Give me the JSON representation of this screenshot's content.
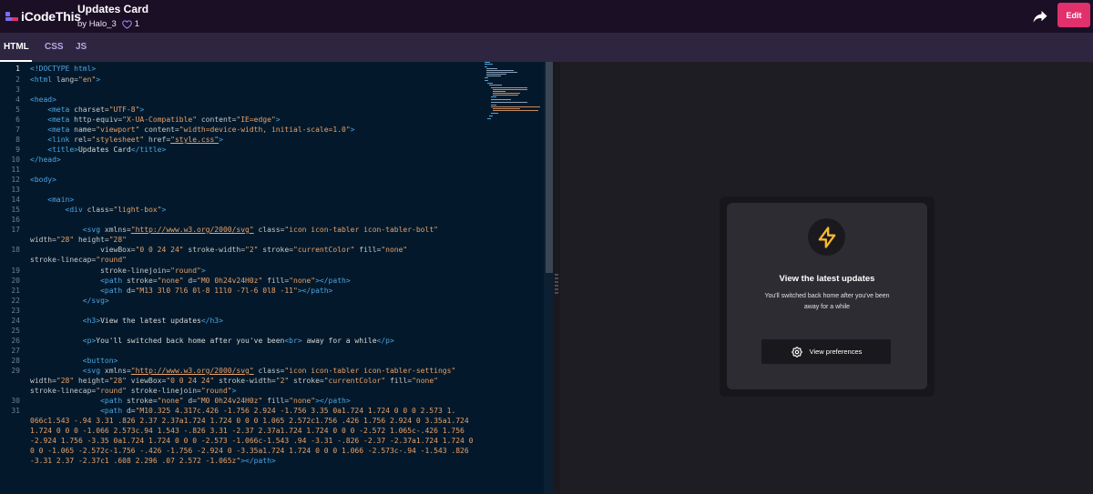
{
  "app": {
    "logo_text": "iCodeThis",
    "brand_colors": [
      "#7b6cf6",
      "#e1306c"
    ]
  },
  "project": {
    "title": "Updates Card",
    "by_label": "by",
    "author": "Halo_3",
    "likes": "1"
  },
  "actions": {
    "share_icon": "share-arrow-icon",
    "edit_label": "Edit"
  },
  "tabs": [
    {
      "label": "HTML",
      "active": true
    },
    {
      "label": "CSS",
      "active": false
    },
    {
      "label": "JS",
      "active": false
    }
  ],
  "editor": {
    "line_numbers": [
      "1",
      "2",
      "3",
      "4",
      "5",
      "6",
      "7",
      "8",
      "9",
      "10",
      "11",
      "12",
      "13",
      "14",
      "15",
      "16",
      "17",
      "18",
      "19",
      "20",
      "21",
      "22",
      "23",
      "24",
      "25",
      "26",
      "27",
      "28",
      "29",
      "30",
      "31"
    ],
    "code": {
      "l1": "<!DOCTYPE html>",
      "l2a": "<html ",
      "l2b": "lang=",
      "l2c": "\"en\"",
      "l2d": ">",
      "l4": "<head>",
      "l5a": "    <meta ",
      "l5b": "charset=",
      "l5c": "\"UTF-8\"",
      "l5d": ">",
      "l6a": "    <meta ",
      "l6b": "http-equiv=",
      "l6c": "\"X-UA-Compatible\"",
      "l6d": " content=",
      "l6e": "\"IE=edge\"",
      "l6f": ">",
      "l7a": "    <meta ",
      "l7b": "name=",
      "l7c": "\"viewport\"",
      "l7d": " content=",
      "l7e": "\"width=device-width, initial-scale=1.0\"",
      "l7f": ">",
      "l8a": "    <link ",
      "l8b": "rel=",
      "l8c": "\"stylesheet\"",
      "l8d": " href=",
      "l8e": "\"style.css\"",
      "l8f": ">",
      "l9a": "    <title>",
      "l9b": "Updates Card",
      "l9c": "</title>",
      "l10": "</head>",
      "l12": "<body>",
      "l14": "    <main>",
      "l15a": "        <div ",
      "l15b": "class=",
      "l15c": "\"light-box\"",
      "l15d": ">",
      "l17a": "            <svg ",
      "l17b": "xmlns=",
      "l17c": "\"http://www.w3.org/2000/svg\"",
      "l17d": " class=",
      "l17e": "\"icon icon-tabler icon-tabler-bolt\"",
      "l17w1": "width=",
      "l17w2": "\"28\"",
      "l17w3": " height=",
      "l17w4": "\"28\"",
      "l18a": "                viewBox=",
      "l18b": "\"0 0 24 24\"",
      "l18c": " stroke-width=",
      "l18d": "\"2\"",
      "l18e": " stroke=",
      "l18f": "\"currentColor\"",
      "l18g": " fill=",
      "l18h": "\"none\"",
      "l18w1": "stroke-linecap=",
      "l18w2": "\"round\"",
      "l19a": "                stroke-linejoin=",
      "l19b": "\"round\"",
      "l19c": ">",
      "l20a": "                <path ",
      "l20b": "stroke=",
      "l20c": "\"none\"",
      "l20d": " d=",
      "l20e": "\"M0 0h24v24H0z\"",
      "l20f": " fill=",
      "l20g": "\"none\"",
      "l20h": "></path>",
      "l21a": "                <path ",
      "l21b": "d=",
      "l21c": "\"M13 3l0 7l6 0l-8 11l0 -7l-6 0l8 -11\"",
      "l21d": "></path>",
      "l22": "            </svg>",
      "l24a": "            <h3>",
      "l24b": "View the latest updates",
      "l24c": "</h3>",
      "l26a": "            <p>",
      "l26b": "You'll switched back home after you've been",
      "l26c": "<br>",
      "l26d": " away for a while",
      "l26e": "</p>",
      "l28": "            <button>",
      "l29a": "            <svg ",
      "l29b": "xmlns=",
      "l29c": "\"http://www.w3.org/2000/svg\"",
      "l29d": " class=",
      "l29e": "\"icon icon-tabler icon-tabler-settings\"",
      "l29w1": "width=",
      "l29w2": "\"28\"",
      "l29w3": " height=",
      "l29w4": "\"28\"",
      "l29w5": " viewBox=",
      "l29w6": "\"0 0 24 24\"",
      "l29w7": " stroke-width=",
      "l29w8": "\"2\"",
      "l29w9": " stroke=",
      "l29w10": "\"currentColor\"",
      "l29w11": " fill=",
      "l29w12": "\"none\"",
      "l29x1": "stroke-linecap=",
      "l29x2": "\"round\"",
      "l29x3": " stroke-linejoin=",
      "l29x4": "\"round\"",
      "l29x5": ">",
      "l30a": "                <path ",
      "l30b": "stroke=",
      "l30c": "\"none\"",
      "l30d": " d=",
      "l30e": "\"M0 0h24v24H0z\"",
      "l30f": " fill=",
      "l30g": "\"none\"",
      "l30h": "></path>",
      "l31a": "                <path ",
      "l31b": "d=",
      "l31c": "\"M10.325 4.317c.426 -1.756 2.924 -1.756 3.35 0a1.724 1.724 0 0 0 2.573 1.",
      "l31w1": "066c1.543 -.94 3.31 .826 2.37 2.37a1.724 1.724 0 0 0 1.065 2.572c1.756 .426 1.756 2.924 0 3.35a1.724",
      "l31w2": "1.724 0 0 0 -1.066 2.573c.94 1.543 -.826 3.31 -2.37 2.37a1.724 1.724 0 0 0 -2.572 1.065c-.426 1.756",
      "l31w3": "-2.924 1.756 -3.35 0a1.724 1.724 0 0 0 -2.573 -1.066c-1.543 .94 -3.31 -.826 -2.37 -2.37a1.724 1.724 0",
      "l31w4": "0 0 -1.065 -2.572c-1.756 -.426 -1.756 -2.924 0 -3.35a1.724 1.724 0 0 0 1.066 -2.573c-.94 -1.543 .826",
      "l31w5": "-3.31 2.37 -2.37c1 .608 2.296 .07 2.572 -1.065z\"",
      "l31w6": "></path>"
    }
  },
  "preview": {
    "bolt_icon": "bolt-icon",
    "bolt_color": "#f5b82e",
    "title": "View the latest updates",
    "text_line1": "You'll switched back home after you've been",
    "text_line2": "away for a while",
    "button_label": "View preferences",
    "button_icon": "settings-gear-icon"
  }
}
